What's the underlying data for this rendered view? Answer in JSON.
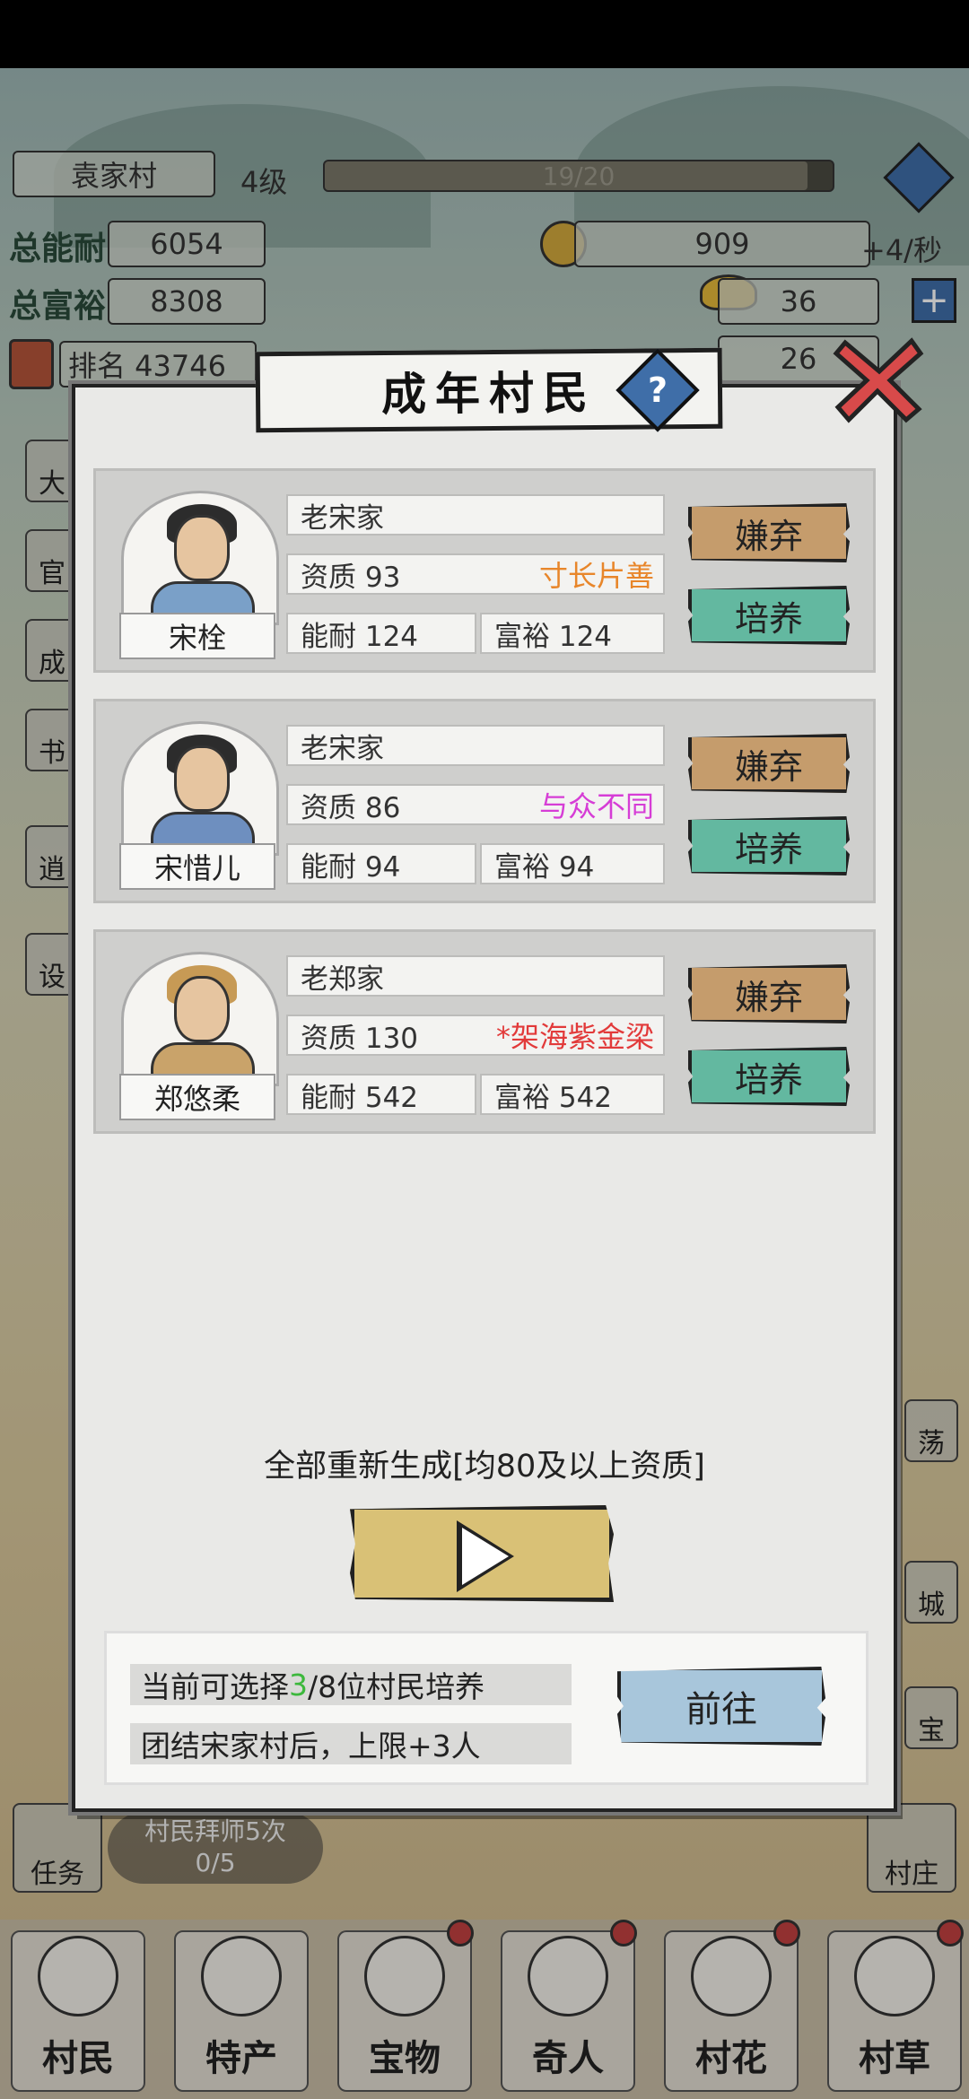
{
  "hud": {
    "village_name": "袁家村",
    "level": "4级",
    "progress_text": "19/20",
    "progress_fraction": 0.95,
    "total_ability_label": "总能耐",
    "total_ability": "6054",
    "total_wealth_label": "总富裕",
    "total_wealth": "8308",
    "coins": "909",
    "coin_rate": "+4/秒",
    "gold": "36",
    "rank": "排名 43746",
    "other_count": "26"
  },
  "background": {
    "task_label": "任务",
    "apprentice_text": "村民拜师5次",
    "apprentice_progress": "0/5",
    "right_icons": [
      "荡",
      "城",
      "宝",
      "村庄"
    ],
    "left_icons": [
      "大",
      "官",
      "成",
      "书",
      "逍",
      "设"
    ]
  },
  "bottom_nav": [
    "村民",
    "特产",
    "宝物",
    "奇人",
    "村花",
    "村草"
  ],
  "modal": {
    "title": "成年村民",
    "help": "?",
    "villagers": [
      {
        "name": "宋栓",
        "family": "老宋家",
        "aptitude": "资质 93",
        "trait": "寸长片善",
        "trait_color": "#e8862a",
        "ability": "能耐 124",
        "wealth": "富裕 124",
        "abandon": "嫌弃",
        "train": "培养"
      },
      {
        "name": "宋惜儿",
        "family": "老宋家",
        "aptitude": "资质 86",
        "trait": "与众不同",
        "trait_color": "#d63dd6",
        "ability": "能耐 94",
        "wealth": "富裕 94",
        "abandon": "嫌弃",
        "train": "培养"
      },
      {
        "name": "郑悠柔",
        "family": "老郑家",
        "aptitude": "资质 130",
        "trait": "*架海紫金梁",
        "trait_color": "#e23a3a",
        "ability": "能耐 542",
        "wealth": "富裕 542",
        "abandon": "嫌弃",
        "train": "培养"
      }
    ],
    "regen_text": "全部重新生成[均80及以上资质]",
    "info": {
      "line1_prefix": "当前可选择",
      "line1_count": "3",
      "line1_suffix": "/8位村民培养",
      "line1_count_color": "#3cb83c",
      "line2": "团结宋家村后，上限+3人"
    },
    "goto": "前往"
  }
}
